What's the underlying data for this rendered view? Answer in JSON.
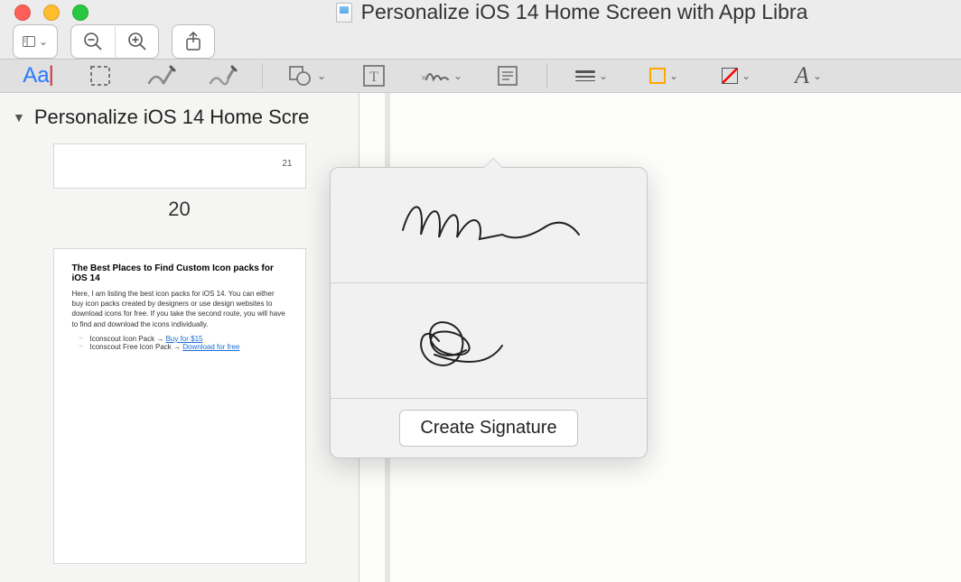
{
  "window": {
    "title": "Personalize iOS 14 Home Screen with App Libra"
  },
  "sidebar": {
    "doc_title": "Personalize iOS 14 Home Scre",
    "thumb1_page_number": "21",
    "current_page_label": "20",
    "article": {
      "heading": "The Best Places to Find Custom Icon packs for iOS 14",
      "blurb": "Here, I am listing the best icon packs for iOS 14. You can either buy icon packs created by designers or use design websites to download icons for free. If you take the second route, you will have to find and download the icons individually.",
      "bullet1_label": "Iconscout Icon Pack →",
      "bullet1_link": "Buy for $15",
      "bullet2_label": "Iconscout Free Icon Pack →",
      "bullet2_link": "Download for free"
    }
  },
  "popover": {
    "create_signature_label": "Create Signature"
  },
  "markup": {
    "text_tool_label": "Aa"
  }
}
